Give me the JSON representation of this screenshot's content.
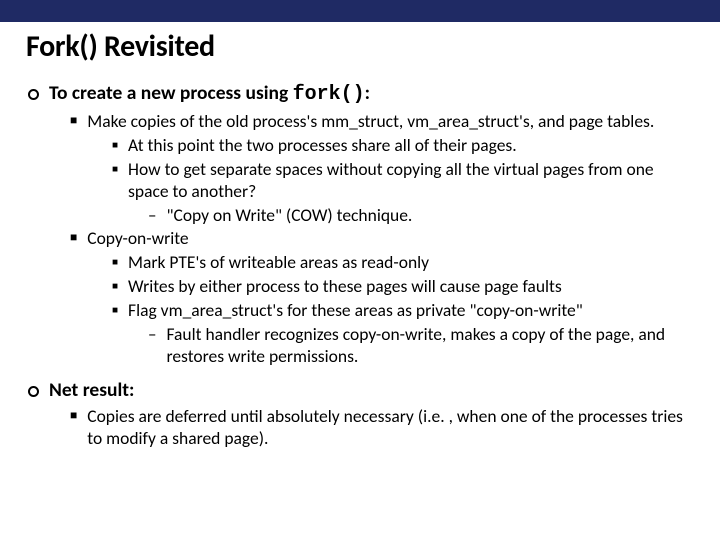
{
  "title": "Fork() Revisited",
  "p0_a": "To create a new process using ",
  "p0_code": "fork()",
  "p0_b": ":",
  "p1": "Make copies of the old process's mm_struct, vm_area_struct's, and page tables.",
  "p1a": "At this point the two processes share all of their pages.",
  "p1b": "How to get separate spaces without copying all the virtual pages from one space to another?",
  "p1b1": "\"Copy on Write\" (COW) technique.",
  "p2": "Copy-on-write",
  "p2a": "Mark PTE's of  writeable areas as read-only",
  "p2b": "Writes by either process to these pages will cause page faults",
  "p2c": "Flag vm_area_struct's for these areas as private \"copy-on-write\"",
  "p2c1": "Fault handler recognizes copy-on-write, makes a copy of the page, and restores write permissions.",
  "p3": "Net result:",
  "p3a": "Copies are deferred until absolutely necessary (i.e. , when one of the processes tries to modify a shared page)."
}
